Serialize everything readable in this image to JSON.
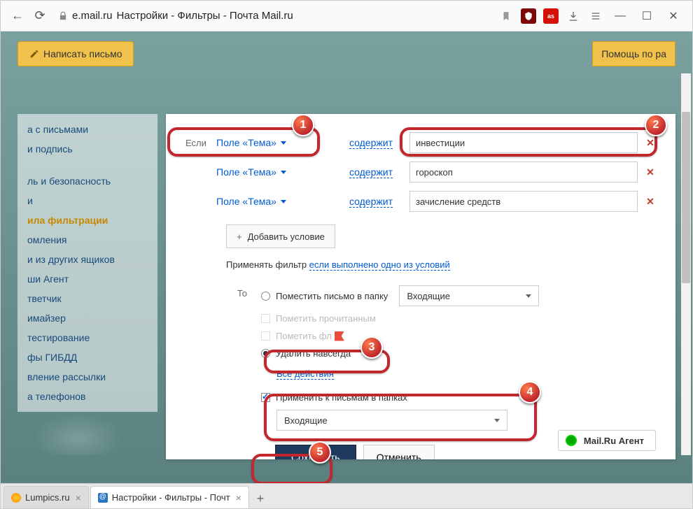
{
  "browser": {
    "url_host": "e.mail.ru",
    "page_title": "Настройки - Фильтры - Почта Mail.ru",
    "ext_lastfm": "as"
  },
  "app": {
    "compose": "Написать письмо",
    "help": "Помощь по ра"
  },
  "sidebar": {
    "items": [
      "а с письмами",
      "и подпись",
      "ль и безопасность",
      "и",
      "ила фильтрации",
      "омления",
      "и из других ящиков",
      "ши Агент",
      "тветчик",
      "имайзер",
      "тестирование",
      "фы ГИБДД",
      "вление рассылки",
      "а телефонов"
    ],
    "active_index": 4
  },
  "filter": {
    "if_label": "Если",
    "field_label": "Поле «Тема»",
    "contains": "содержит",
    "conditions": [
      {
        "value": "инвестиции"
      },
      {
        "value": "гороскоп"
      },
      {
        "value": "зачисление средств"
      }
    ],
    "add_condition": "Добавить условие",
    "apply_prefix": "Применять фильтр ",
    "apply_link": "если выполнено одно из условий",
    "then_label": "То",
    "action_move": "Поместить письмо в папку",
    "folder_inbox": "Входящие",
    "action_read": "Пометить прочитанным",
    "action_flag": "Пометить фл",
    "action_delete": "Удалить навсегда",
    "all_actions": "Все действия",
    "apply_folders_label": "Применить к письмам в папках",
    "apply_folders_value": "Входящие",
    "save": "Сохранить",
    "cancel": "Отменить"
  },
  "agent": "Mail.Ru Агент",
  "tabs": [
    {
      "title": "Lumpics.ru",
      "fav": "orange"
    },
    {
      "title": "Настройки - Фильтры - Почт",
      "fav": "blue"
    }
  ]
}
